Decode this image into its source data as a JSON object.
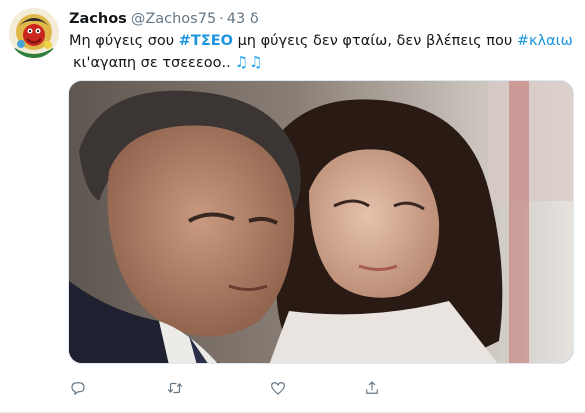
{
  "tweet": {
    "display_name": "Zachos",
    "handle": "@Zachos75",
    "separator": "·",
    "timestamp": "43 δ",
    "text": {
      "part1": "Μη φύγεις σου ",
      "hashtag1": "#ΤΣΕΟ",
      "part2": " μη φύγεις δεν φταίω, δεν βλέπεις που ",
      "hashtag2": "#κλαιω",
      "part3": " κι'αγαπη σε τσεεεοο..",
      "emoji": "♫♫"
    },
    "media": {
      "icon": "photo-image"
    },
    "actions": [
      {
        "icon": "reply-icon"
      },
      {
        "icon": "retweet-icon"
      },
      {
        "icon": "like-icon"
      },
      {
        "icon": "share-icon"
      }
    ]
  },
  "colors": {
    "link": "#1b95e0",
    "secondary_text": "#657786",
    "primary_text": "#14171a",
    "border": "#e6ecf0"
  }
}
